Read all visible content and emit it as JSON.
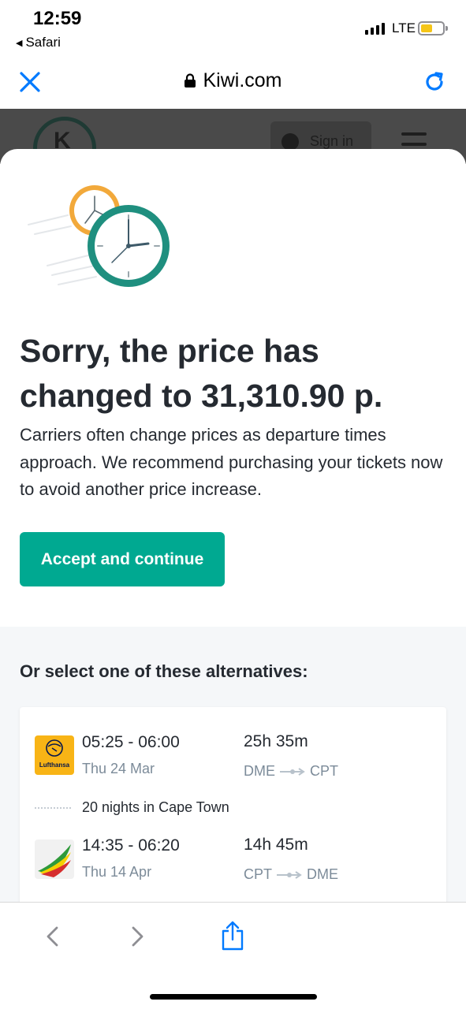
{
  "status": {
    "time": "12:59",
    "back_app": "Safari",
    "network": "LTE"
  },
  "browser": {
    "url": "Kiwi.com"
  },
  "site": {
    "signin_label": "Sign in"
  },
  "modal": {
    "headline": "Sorry, the price has changed to 31,310.90 р.",
    "description": "Carriers often change prices as departure times approach. We recommend purchasing your tickets now to avoid another price increase.",
    "accept_label": "Accept and continue",
    "alternatives_title": "Or select one of these alternatives:",
    "itinerary": {
      "outbound": {
        "carrier_logo_text": "Lufthansa",
        "times": "05:25 - 06:00",
        "date": "Thu 24 Mar",
        "duration": "25h 35m",
        "from": "DME",
        "to": "CPT"
      },
      "stay": "20 nights in Cape Town",
      "inbound": {
        "times": "14:35 - 06:20",
        "date": "Thu 14 Apr",
        "duration": "14h 45m",
        "from": "CPT",
        "to": "DME"
      }
    }
  },
  "colors": {
    "accent": "#00a991",
    "ios_blue": "#007aff",
    "text": "#252a31",
    "muted": "#7c8b99",
    "clock_teal": "#1f8f7f",
    "clock_orange": "#f2a93b"
  },
  "icons": [
    "close-icon",
    "lock-icon",
    "reload-icon",
    "back-icon",
    "forward-icon",
    "share-icon"
  ]
}
